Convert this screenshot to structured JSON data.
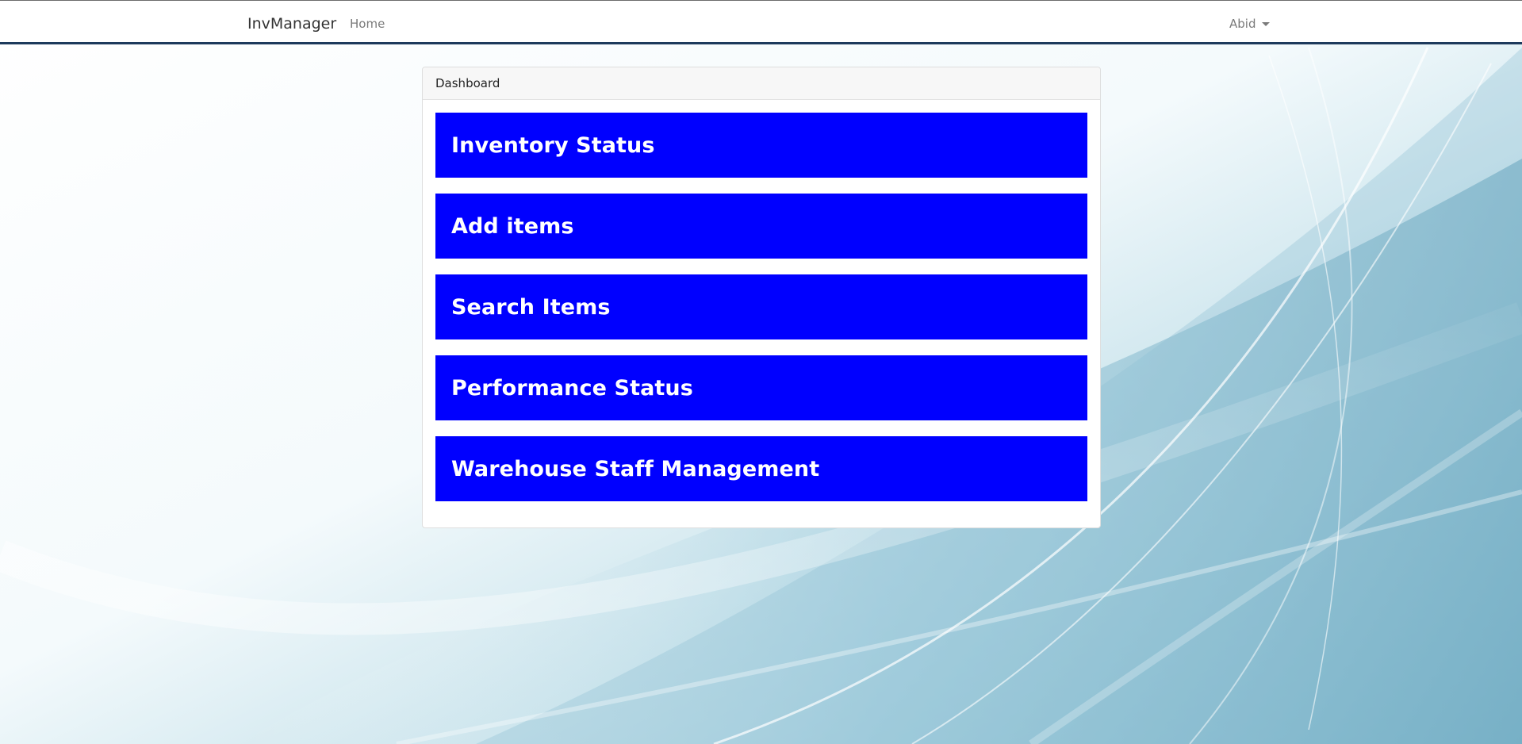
{
  "navbar": {
    "brand": "InvManager",
    "home_label": "Home",
    "user_label": "Abid"
  },
  "dashboard": {
    "header": "Dashboard",
    "buttons": [
      {
        "label": "Inventory Status"
      },
      {
        "label": "Add items"
      },
      {
        "label": "Search Items"
      },
      {
        "label": "Performance Status"
      },
      {
        "label": "Warehouse Staff Management"
      }
    ]
  },
  "colors": {
    "button_bg": "#0000ff",
    "button_text": "#ffffff",
    "navbar_border": "#1d3a5c"
  }
}
